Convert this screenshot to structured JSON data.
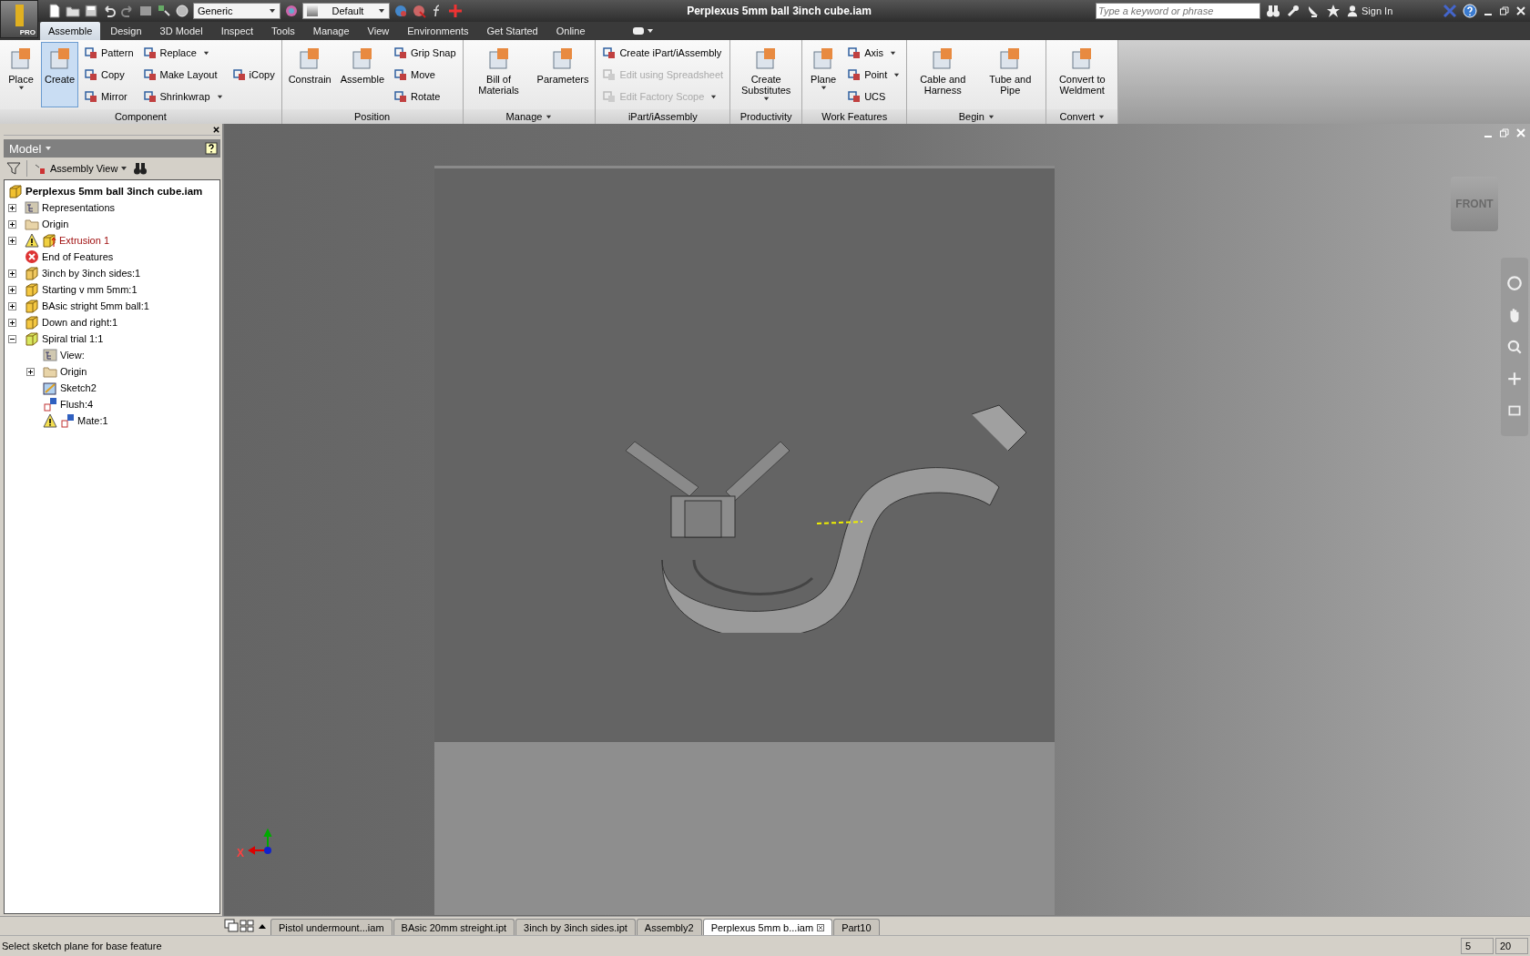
{
  "app_button": {
    "badge": "PRO"
  },
  "quick_access": {
    "material": "Generic",
    "appearance": "Default"
  },
  "window": {
    "title": "Perplexus 5mm ball 3inch cube.iam"
  },
  "search": {
    "placeholder": "Type a keyword or phrase"
  },
  "account": {
    "label": "Sign In"
  },
  "menu_tabs": [
    {
      "label": "Assemble",
      "selected": true
    },
    {
      "label": "Design",
      "selected": false
    },
    {
      "label": "3D Model",
      "selected": false
    },
    {
      "label": "Inspect",
      "selected": false
    },
    {
      "label": "Tools",
      "selected": false
    },
    {
      "label": "Manage",
      "selected": false
    },
    {
      "label": "View",
      "selected": false
    },
    {
      "label": "Environments",
      "selected": false
    },
    {
      "label": "Get Started",
      "selected": false
    },
    {
      "label": "Online",
      "selected": false
    }
  ],
  "ribbon": [
    {
      "title": "Component",
      "menu": false,
      "tools": [
        {
          "label": "Place",
          "kind": "large",
          "dropdown": true,
          "selected": false,
          "disabled": false
        },
        {
          "label": "Create",
          "kind": "large",
          "dropdown": false,
          "selected": true,
          "disabled": false
        },
        {
          "label": "Pattern",
          "kind": "small",
          "dropdown": false,
          "selected": false,
          "disabled": false
        },
        {
          "label": "Copy",
          "kind": "small",
          "dropdown": false,
          "selected": false,
          "disabled": false
        },
        {
          "label": "Mirror",
          "kind": "small",
          "dropdown": false,
          "selected": false,
          "disabled": false
        },
        {
          "label": "Replace",
          "kind": "small",
          "dropdown": true,
          "selected": false,
          "disabled": false
        },
        {
          "label": "Make Layout",
          "kind": "small",
          "dropdown": false,
          "selected": false,
          "disabled": false
        },
        {
          "label": "Shrinkwrap",
          "kind": "small",
          "dropdown": true,
          "selected": false,
          "disabled": false
        },
        {
          "label": "iCopy",
          "kind": "small",
          "dropdown": false,
          "selected": false,
          "disabled": false
        }
      ]
    },
    {
      "title": "Position",
      "menu": false,
      "tools": [
        {
          "label": "Constrain",
          "kind": "large",
          "dropdown": false,
          "selected": false,
          "disabled": false
        },
        {
          "label": "Assemble",
          "kind": "large",
          "dropdown": false,
          "selected": false,
          "disabled": false
        },
        {
          "label": "Grip Snap",
          "kind": "small",
          "dropdown": false,
          "selected": false,
          "disabled": false
        },
        {
          "label": "Move",
          "kind": "small",
          "dropdown": false,
          "selected": false,
          "disabled": false
        },
        {
          "label": "Rotate",
          "kind": "small",
          "dropdown": false,
          "selected": false,
          "disabled": false
        }
      ]
    },
    {
      "title": "Manage",
      "menu": true,
      "tools": [
        {
          "label": "Bill of Materials",
          "kind": "large",
          "dropdown": false,
          "selected": false,
          "disabled": false
        },
        {
          "label": "Parameters",
          "kind": "large",
          "dropdown": false,
          "selected": false,
          "disabled": false
        }
      ]
    },
    {
      "title": "iPart/iAssembly",
      "menu": false,
      "tools": [
        {
          "label": "Create iPart/iAssembly",
          "kind": "small",
          "dropdown": false,
          "selected": false,
          "disabled": false
        },
        {
          "label": "Edit using Spreadsheet",
          "kind": "small",
          "dropdown": false,
          "selected": false,
          "disabled": true
        },
        {
          "label": "Edit Factory Scope",
          "kind": "small",
          "dropdown": true,
          "selected": false,
          "disabled": true
        }
      ]
    },
    {
      "title": "Productivity",
      "menu": false,
      "tools": [
        {
          "label": "Create Substitutes",
          "kind": "large",
          "dropdown": true,
          "selected": false,
          "disabled": false
        }
      ]
    },
    {
      "title": "Work Features",
      "menu": false,
      "tools": [
        {
          "label": "Plane",
          "kind": "large",
          "dropdown": true,
          "selected": false,
          "disabled": false
        },
        {
          "label": "Axis",
          "kind": "small",
          "dropdown": true,
          "selected": false,
          "disabled": false
        },
        {
          "label": "Point",
          "kind": "small",
          "dropdown": true,
          "selected": false,
          "disabled": false
        },
        {
          "label": "UCS",
          "kind": "small",
          "dropdown": false,
          "selected": false,
          "disabled": false
        }
      ]
    },
    {
      "title": "Begin",
      "menu": true,
      "tools": [
        {
          "label": "Cable and Harness",
          "kind": "large",
          "dropdown": false,
          "selected": false,
          "disabled": false
        },
        {
          "label": "Tube and Pipe",
          "kind": "large",
          "dropdown": false,
          "selected": false,
          "disabled": false
        }
      ]
    },
    {
      "title": "Convert",
      "menu": true,
      "tools": [
        {
          "label": "Convert to Weldment",
          "kind": "large",
          "dropdown": false,
          "selected": false,
          "disabled": false
        }
      ]
    }
  ],
  "browser": {
    "title": "Model",
    "view": "Assembly View",
    "tree": [
      {
        "label": "Perplexus 5mm ball 3inch cube.iam",
        "kind": "assembly",
        "warning": false,
        "failed": false,
        "children": [
          {
            "label": "Representations",
            "kind": "representations",
            "expanded": false,
            "warning": false,
            "failed": false
          },
          {
            "label": "Origin",
            "kind": "folder",
            "expanded": false,
            "warning": false,
            "failed": false
          },
          {
            "label": "Extrusion 1",
            "kind": "feature",
            "expanded": false,
            "warning": true,
            "failed": true
          },
          {
            "label": "End of Features",
            "kind": "end",
            "warning": false,
            "failed": false
          },
          {
            "label": "3inch by 3inch sides:1",
            "kind": "adaptive",
            "expanded": false,
            "warning": false,
            "failed": false
          },
          {
            "label": "Starting v mm 5mm:1",
            "kind": "part",
            "expanded": false,
            "warning": false,
            "failed": false
          },
          {
            "label": "BAsic stright 5mm ball:1",
            "kind": "part",
            "expanded": false,
            "warning": false,
            "failed": false
          },
          {
            "label": "Down and right:1",
            "kind": "part",
            "expanded": false,
            "warning": false,
            "failed": false
          },
          {
            "label": "Spiral trial 1:1",
            "kind": "active",
            "expanded": true,
            "warning": false,
            "failed": false,
            "children": [
              {
                "label": "View:",
                "kind": "representations",
                "warning": false,
                "failed": false
              },
              {
                "label": "Origin",
                "kind": "folder",
                "expanded": false,
                "warning": false,
                "failed": false
              },
              {
                "label": "Sketch2",
                "kind": "sketch",
                "warning": false,
                "failed": false
              },
              {
                "label": "Flush:4",
                "kind": "constraint",
                "warning": false,
                "failed": false
              },
              {
                "label": "Mate:1",
                "kind": "constraint",
                "warning": true,
                "failed": false
              }
            ]
          }
        ]
      }
    ]
  },
  "viewport": {
    "view_cube": "FRONT",
    "axis_label": "X"
  },
  "doc_tabs": [
    {
      "label": "Pistol undermount...iam",
      "selected": false
    },
    {
      "label": "BAsic 20mm streight.ipt",
      "selected": false
    },
    {
      "label": "3inch by 3inch sides.ipt",
      "selected": false
    },
    {
      "label": "Assembly2",
      "selected": false
    },
    {
      "label": "Perplexus 5mm b...iam",
      "selected": true
    },
    {
      "label": "Part10",
      "selected": false
    }
  ],
  "status_bar": {
    "message": "Select sketch plane for base feature",
    "cells": [
      "5",
      "20"
    ]
  }
}
